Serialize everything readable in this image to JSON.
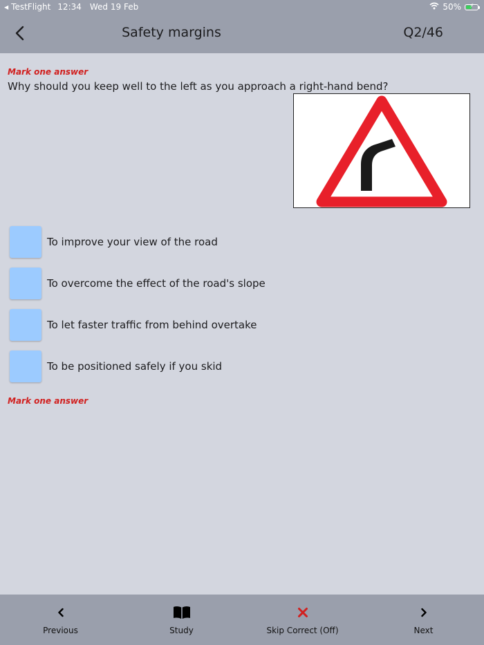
{
  "status_bar": {
    "carrier": "TestFlight",
    "time": "12:34",
    "date": "Wed 19 Feb",
    "battery": "50%",
    "battery_level": 0.5,
    "wifi_icon": "wifi-icon",
    "battery_icon": "battery-charging-icon"
  },
  "nav": {
    "back_icon": "chevron-left-icon",
    "title": "Safety margins",
    "counter": "Q2/46"
  },
  "question": {
    "instruction": "Mark one answer",
    "text": "Why should you keep well to the left as you approach a right-hand bend?",
    "image": "right-bend-warning-sign",
    "answers": [
      {
        "label": "To improve your view of the road",
        "selected": false
      },
      {
        "label": "To overcome the effect of the road's slope",
        "selected": false
      },
      {
        "label": "To let faster traffic from behind overtake",
        "selected": false
      },
      {
        "label": "To be positioned safely if you skid",
        "selected": false
      }
    ],
    "footer_instruction": "Mark one answer"
  },
  "tab_bar": {
    "previous": "Previous",
    "study": "Study",
    "skip_correct": "Skip Correct (Off)",
    "next": "Next"
  },
  "colors": {
    "bar": "#9a9fac",
    "background": "#d3d6df",
    "checkbox": "#9ccbff",
    "instruction": "#d1201f",
    "skip_icon": "#d1201f",
    "sign_border": "#e8202a"
  }
}
